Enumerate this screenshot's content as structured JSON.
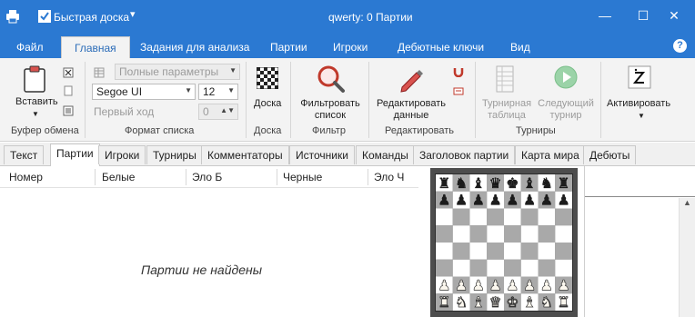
{
  "app": {
    "quick_board_label": "Быстрая доска",
    "title": "qwerty:  0 Партии",
    "window_controls": {
      "minimize": "—",
      "maximize": "☐",
      "close": "✕"
    }
  },
  "ribbon_tabs": [
    "Файл",
    "Главная",
    "Задания для анализа",
    "Партии",
    "Игроки",
    "Дебютные ключи",
    "Вид"
  ],
  "help_label": "?",
  "ribbon": {
    "clipboard": {
      "paste_label": "Вставить",
      "group_label": "Буфер обмена"
    },
    "list_format": {
      "preset_value": "Полные параметры",
      "font_value": "Segoe UI",
      "size_value": "12",
      "first_move_label": "Первый ход",
      "first_move_value": "0",
      "group_label": "Формат списка"
    },
    "board": {
      "board_label": "Доска",
      "group_label": "Доска"
    },
    "filter": {
      "filter_line1": "Фильтровать",
      "filter_line2": "список",
      "group_label": "Фильтр"
    },
    "editing": {
      "edit_line1": "Редактировать",
      "edit_line2": "данные",
      "group_label": "Редактировать"
    },
    "tournaments": {
      "table_line1": "Турнирная",
      "table_line2": "таблица",
      "next_line1": "Следующий",
      "next_line2": "турнир",
      "group_label": "Турниры"
    },
    "activate": {
      "label": "Активировать"
    }
  },
  "content_tabs": [
    "Текст",
    "Партии",
    "Игроки",
    "Турниры",
    "Комментаторы",
    "Источники",
    "Команды",
    "Заголовок партии",
    "Карта мира",
    "Дебюты"
  ],
  "table": {
    "columns": [
      "Номер",
      "Белые",
      "Эло Б",
      "Черные",
      "Эло Ч"
    ],
    "empty_message": "Партии не найдены"
  },
  "colors": {
    "accent": "#2b79d2",
    "ribbon_bg": "#f3f3f3",
    "board_light": "#ffffff",
    "board_dark": "#a9a9a9"
  },
  "board_position": [
    [
      "r",
      "n",
      "b",
      "q",
      "k",
      "b",
      "n",
      "r"
    ],
    [
      "p",
      "p",
      "p",
      "p",
      "p",
      "p",
      "p",
      "p"
    ],
    [
      "",
      "",
      "",
      "",
      "",
      "",
      "",
      ""
    ],
    [
      "",
      "",
      "",
      "",
      "",
      "",
      "",
      ""
    ],
    [
      "",
      "",
      "",
      "",
      "",
      "",
      "",
      ""
    ],
    [
      "",
      "",
      "",
      "",
      "",
      "",
      "",
      ""
    ],
    [
      "P",
      "P",
      "P",
      "P",
      "P",
      "P",
      "P",
      "P"
    ],
    [
      "R",
      "N",
      "B",
      "Q",
      "K",
      "B",
      "N",
      "R"
    ]
  ]
}
